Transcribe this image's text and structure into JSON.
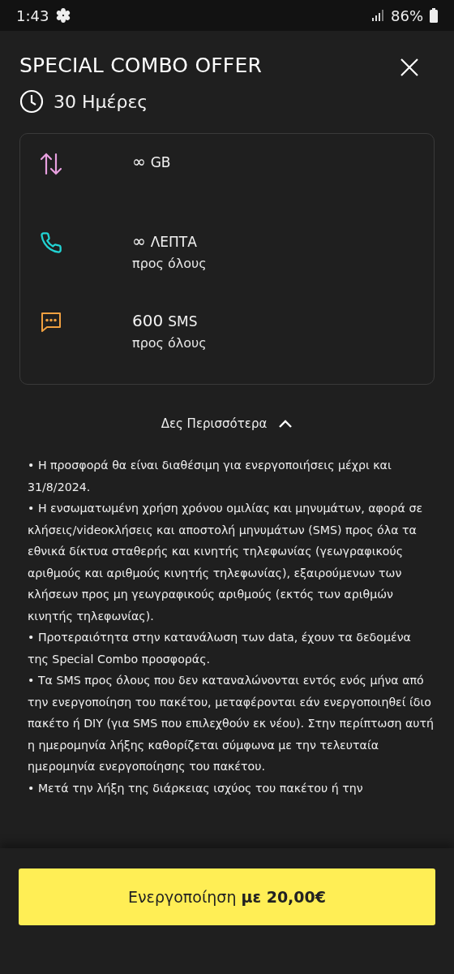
{
  "status_bar": {
    "time": "1:43",
    "battery": "86%"
  },
  "header": {
    "title": "SPECIAL COMBO OFFER",
    "duration": "30 Ημέρες"
  },
  "allowances": [
    {
      "kind": "data",
      "amount": "∞",
      "unit": "GB"
    },
    {
      "kind": "calls",
      "amount": "∞",
      "unit": "ΛΕΠΤΑ",
      "note": "προς όλους"
    },
    {
      "kind": "sms",
      "amount": "600",
      "unit": "SMS",
      "note": "προς όλους"
    }
  ],
  "details_toggle": {
    "label": "Δες Περισσότερα",
    "expanded": true
  },
  "terms": [
    "• Η προσφορά θα είναι διαθέσιμη για ενεργοποιήσεις μέχρι και 31/8/2024.",
    "• Η ενσωματωμένη χρήση χρόνου ομιλίας και μηνυμάτων, αφορά σε κλήσεις/videoκλήσεις και αποστολή μηνυμάτων (SMS) προς όλα τα εθνικά δίκτυα σταθερής και κινητής τηλεφωνίας (γεωγραφικούς αριθμούς και αριθμούς κινητής τηλεφωνίας), εξαιρούμενων των κλήσεων προς μη γεωγραφικούς αριθμούς (εκτός των αριθμών κινητής τηλεφωνίας).",
    "• Προτεραιότητα στην κατανάλωση των data, έχουν τα δεδομένα της Special Combo προσφοράς.",
    "• Τα SMS προς όλους που δεν καταναλώνονται εντός ενός μήνα από την ενεργοποίηση του πακέτου, μεταφέρονται εάν ενεργοποιηθεί ίδιο πακέτο ή DIY (για SMS που επιλεχθούν εκ νέου). Στην περίπτωση αυτή η ημερομηνία λήξης καθορίζεται σύμφωνα με την τελευταία ημερομηνία ενεργοποίησης του πακέτου.",
    "• Μετά την λήξη της διάρκειας ισχύος του πακέτου ή την"
  ],
  "activate_button": "Ενεργοποίηση **με 20,00€**"
}
